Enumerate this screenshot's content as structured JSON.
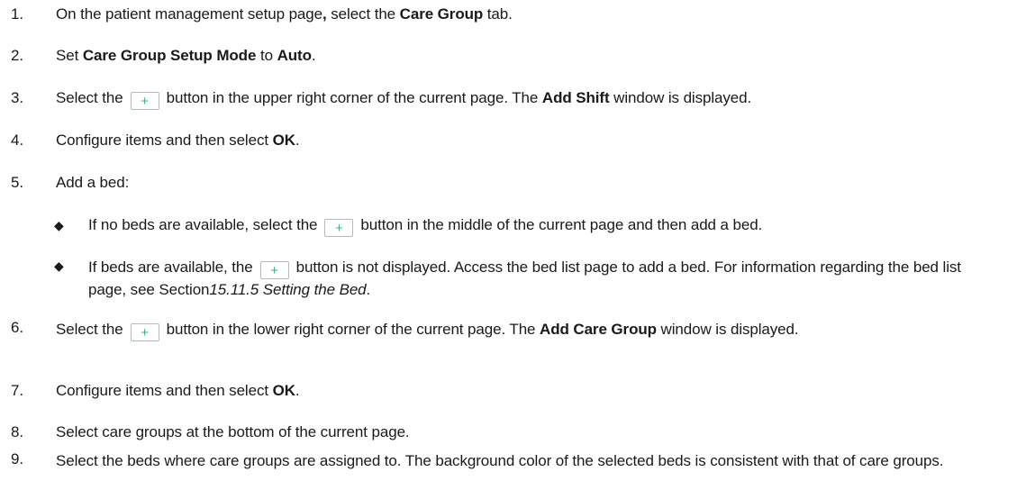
{
  "steps": [
    {
      "num": "1.",
      "parts": [
        "On the patient management setup page",
        ",",
        " select the ",
        "Care Group",
        " tab."
      ]
    },
    {
      "num": "2.",
      "parts": [
        "Set ",
        "Care Group Setup Mode",
        " to ",
        "Auto",
        "."
      ]
    },
    {
      "num": "3.",
      "parts": [
        "Select the",
        "+",
        "button in the upper right corner of the current page. The ",
        "Add Shift",
        " window is displayed."
      ]
    },
    {
      "num": "4.",
      "parts": [
        "Configure items and then select ",
        "OK",
        "."
      ]
    },
    {
      "num": "5.",
      "parts": [
        "Add a bed:"
      ]
    },
    {
      "num": "6.",
      "parts": [
        "Select the",
        "+",
        "button in the lower right corner of the current page. The ",
        "Add Care Group",
        " window is displayed."
      ]
    },
    {
      "num": "7.",
      "parts": [
        "Configure items and then select ",
        "OK",
        "."
      ]
    },
    {
      "num": "8.",
      "parts": [
        "Select care groups at the bottom of the current page."
      ]
    },
    {
      "num": "9.",
      "parts": [
        "Select the beds where care groups are assigned to. The background color of the selected beds is consistent with that of care groups."
      ]
    }
  ],
  "bullets": [
    {
      "marker": "◆",
      "parts": [
        "If no beds are available, select the",
        "+",
        "button in the middle of the current page and then add a bed."
      ]
    },
    {
      "marker": "◆",
      "parts": [
        "If beds are available, the",
        "+",
        "button is not displayed. Access the bed list page to add a bed. For information regarding the bed list page, see Section",
        "15.11.5 Setting the Bed",
        "."
      ]
    }
  ],
  "colors": {
    "text": "#1a1a1a",
    "plus_icon": "#2eb87a",
    "button_border": "#b8b8b8"
  }
}
